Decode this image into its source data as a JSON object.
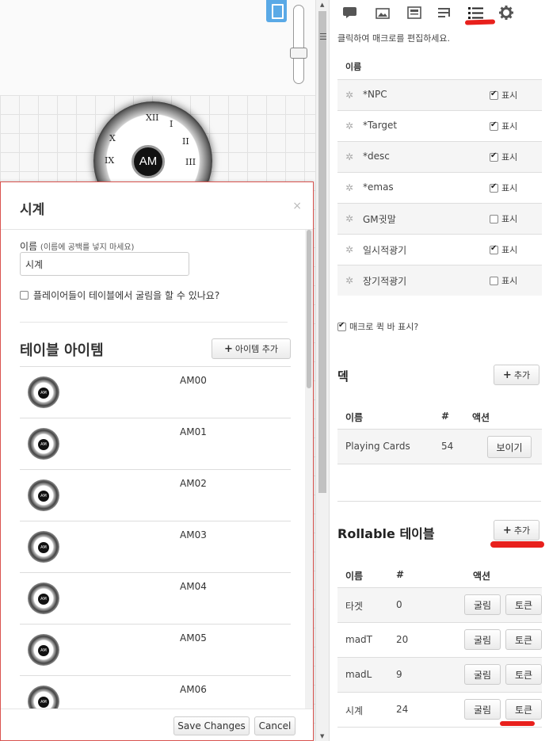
{
  "board": {
    "clock_numerals": [
      "XII",
      "I",
      "II",
      "III",
      "X",
      "IX"
    ],
    "clock_hub_label": "AM",
    "page_icon": "page-icon"
  },
  "modal": {
    "title": "시계",
    "close_label": "×",
    "name_label": "이름",
    "name_hint": "(이름에 공백를 넣지 마세요)",
    "name_value": "시계",
    "players_roll_label": "플레이어들이 테이블에서 굴림을 할 수 있나요?",
    "players_roll_checked": false,
    "table_items_title": "테이블 아이템",
    "add_item_label": "아이템 추가",
    "items": [
      {
        "name": "AM00",
        "icon": "clock-token-thumb"
      },
      {
        "name": "AM01",
        "icon": "clock-token-thumb"
      },
      {
        "name": "AM02",
        "icon": "clock-token-thumb"
      },
      {
        "name": "AM03",
        "icon": "clock-token-thumb"
      },
      {
        "name": "AM04",
        "icon": "clock-token-thumb"
      },
      {
        "name": "AM05",
        "icon": "clock-token-thumb"
      },
      {
        "name": "AM06",
        "icon": "clock-token-thumb"
      }
    ],
    "save_label": "Save Changes",
    "cancel_label": "Cancel"
  },
  "sidebar": {
    "tabs": [
      {
        "icon": "chat-icon"
      },
      {
        "icon": "art-library-icon"
      },
      {
        "icon": "journal-icon"
      },
      {
        "icon": "compendium-icon"
      },
      {
        "icon": "collection-list-icon",
        "active": true
      },
      {
        "icon": "gear-icon"
      }
    ],
    "accent_color": "#e8201c",
    "macro_hint": "클릭하여 매크로를 편집하세요.",
    "macro_header_name": "이름",
    "show_label": "표시",
    "macros": [
      {
        "name": "*NPC",
        "show": true
      },
      {
        "name": "*Target",
        "show": true
      },
      {
        "name": "*desc",
        "show": true
      },
      {
        "name": "*emas",
        "show": true
      },
      {
        "name": "GM귓말",
        "show": false
      },
      {
        "name": "일시적광기",
        "show": true
      },
      {
        "name": "장기적광기",
        "show": false
      }
    ],
    "show_quickbar_label": "매크로 퀵 바 표시?",
    "show_quickbar_checked": true,
    "deck": {
      "title": "덱",
      "add_label": "추가",
      "headers": {
        "name": "이름",
        "count": "#",
        "actions": "액션"
      },
      "rows": [
        {
          "name": "Playing Cards",
          "count": "54",
          "action": "보이기"
        }
      ]
    },
    "rollable": {
      "title": "Rollable 테이블",
      "add_label": "추가",
      "headers": {
        "name": "이름",
        "count": "#",
        "actions": "액션"
      },
      "roll_label": "굴림",
      "token_label": "토큰",
      "rows": [
        {
          "name": "타겟",
          "count": "0"
        },
        {
          "name": "madT",
          "count": "20"
        },
        {
          "name": "madL",
          "count": "9"
        },
        {
          "name": "시계",
          "count": "24"
        }
      ]
    }
  }
}
